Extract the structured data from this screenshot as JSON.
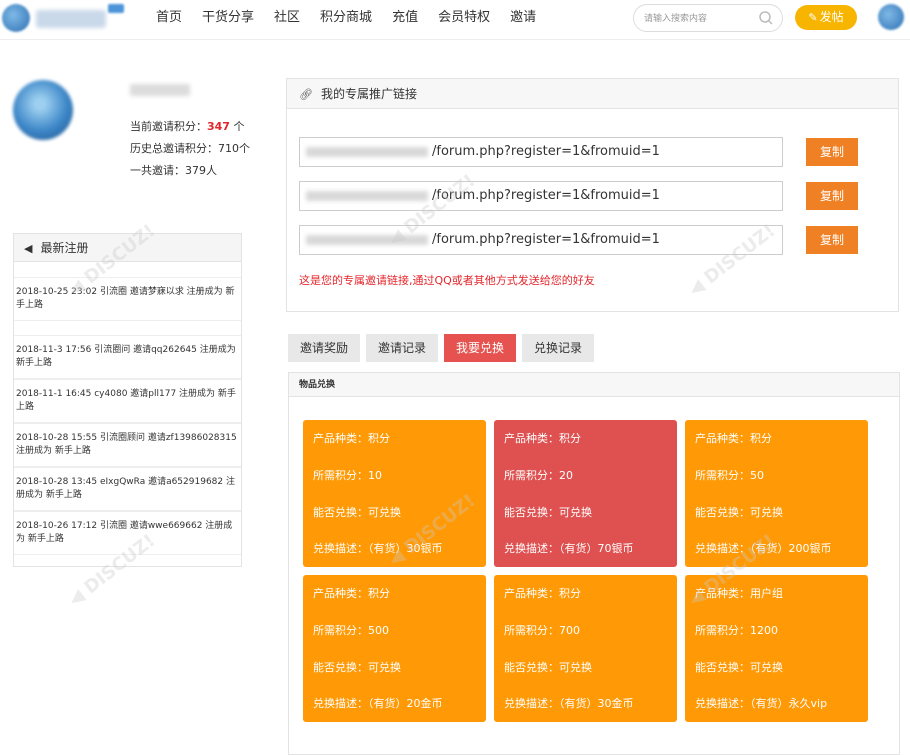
{
  "nav": {
    "items": [
      "首页",
      "干货分享",
      "社区",
      "积分商城",
      "充值",
      "会员特权",
      "邀请"
    ]
  },
  "search": {
    "placeholder": "请输入搜索内容"
  },
  "post_button": {
    "label": "发帖"
  },
  "profile": {
    "stats": [
      {
        "label": "当前邀请积分：",
        "value": "347",
        "suffix": " 个"
      },
      {
        "label": "历史总邀请积分：",
        "value": "710",
        "suffix": "个"
      },
      {
        "label": "一共邀请：",
        "value": "379",
        "suffix": "人"
      }
    ]
  },
  "new_registrations": {
    "title": "最新注册",
    "items": [
      "2018-10-25 23:02 引流圈 邀请梦寐以求 注册成为 新手上路",
      "2018-11-3 17:56 引流圈问 邀请qq262645 注册成为 新手上路",
      "2018-11-1 16:45 cy4080 邀请pll177 注册成为 新手上路",
      "2018-10-28 15:55 引流圈顾问 邀请zf13986028315 注册成为 新手上路",
      "2018-10-28 13:45 eIxgQwRa 邀请a652919682 注册成为 新手上路",
      "2018-10-26 17:12 引流圈 邀请wwe669662 注册成为 新手上路"
    ]
  },
  "promo": {
    "title": "我的专属推广链接",
    "link_suffix": "/forum.php?register=1&fromuid=1",
    "copy_label": "复制",
    "links": 3,
    "hint": "这是您的专属邀请链接,通过QQ或者其他方式发送给您的好友"
  },
  "tabs": [
    "邀请奖励",
    "邀请记录",
    "我要兑换",
    "兑换记录"
  ],
  "active_tab": 2,
  "goods": {
    "title": "物品兑换",
    "labels": {
      "type": "产品种类：",
      "points": "所需积分：",
      "can": "能否兑换：",
      "desc": "兑换描述："
    },
    "cards": [
      {
        "type": "积分",
        "points": "10",
        "can": "可兑换",
        "desc": "（有货）30银币",
        "highlight": false
      },
      {
        "type": "积分",
        "points": "20",
        "can": "可兑换",
        "desc": "（有货）70银币",
        "highlight": true
      },
      {
        "type": "积分",
        "points": "50",
        "can": "可兑换",
        "desc": "（有货）200银币",
        "highlight": false
      },
      {
        "type": "积分",
        "points": "500",
        "can": "可兑换",
        "desc": "（有货）20金币",
        "highlight": false
      },
      {
        "type": "积分",
        "points": "700",
        "can": "可兑换",
        "desc": "（有货）30金币",
        "highlight": false
      },
      {
        "type": "用户组",
        "points": "1200",
        "can": "可兑换",
        "desc": "（有货）永久vip",
        "highlight": false
      }
    ]
  },
  "colors": {
    "accent_orange": "#ff9a06",
    "highlight_red": "#de5150",
    "copy_orange": "#f08024",
    "post_yellow": "#f7b500",
    "text_red": "#e3262b"
  },
  "icons": {
    "search": "search-icon",
    "post": "pencil-icon",
    "link": "link-icon",
    "new_reg": "paper-plane-icon"
  }
}
